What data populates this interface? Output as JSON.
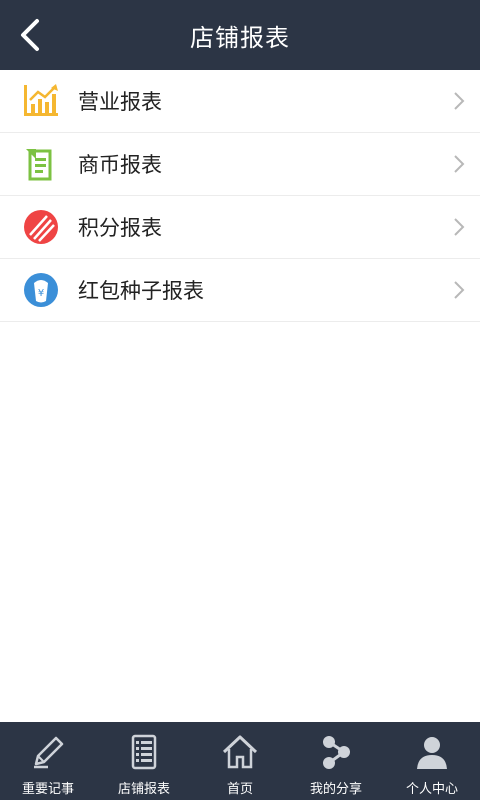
{
  "header": {
    "title": "店铺报表",
    "back_icon": "back-arrow-icon"
  },
  "reports": [
    {
      "label": "营业报表",
      "icon": "bar-chart-icon",
      "color": "#f5b731"
    },
    {
      "label": "商币报表",
      "icon": "receipt-icon",
      "color": "#7cc242"
    },
    {
      "label": "积分报表",
      "icon": "points-icon",
      "color": "#ef4444"
    },
    {
      "label": "红包种子报表",
      "icon": "money-bag-icon",
      "color": "#3b8fd8"
    }
  ],
  "tabbar": {
    "items": [
      {
        "label": "重要记事",
        "icon": "pen-icon"
      },
      {
        "label": "店铺报表",
        "icon": "document-icon"
      },
      {
        "label": "首页",
        "icon": "home-icon"
      },
      {
        "label": "我的分享",
        "icon": "share-icon"
      },
      {
        "label": "个人中心",
        "icon": "person-icon"
      }
    ]
  },
  "colors": {
    "header_bg": "#2c3545",
    "tabbar_bg": "#2c3545"
  }
}
